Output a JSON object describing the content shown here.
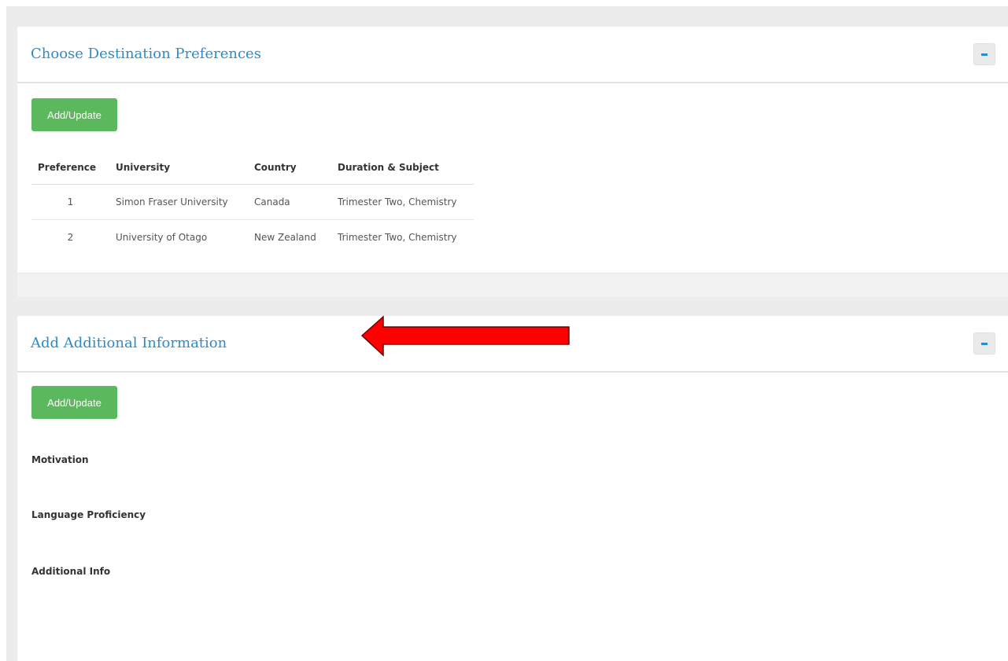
{
  "panels": {
    "destination": {
      "title": "Choose Destination Preferences",
      "add_update_label": "Add/Update",
      "collapse_symbol": "-",
      "table": {
        "headers": [
          "Preference",
          "University",
          "Country",
          "Duration & Subject"
        ],
        "rows": [
          {
            "preference": "1",
            "university": "Simon Fraser University",
            "country": "Canada",
            "duration_subject": "Trimester Two, Chemistry"
          },
          {
            "preference": "2",
            "university": "University of Otago",
            "country": "New Zealand",
            "duration_subject": "Trimester Two, Chemistry"
          }
        ]
      }
    },
    "additional": {
      "title": "Add Additional Information",
      "add_update_label": "Add/Update",
      "collapse_symbol": "-",
      "labels": {
        "motivation": "Motivation",
        "language": "Language Proficiency",
        "additional_info": "Additional Info"
      }
    }
  },
  "colors": {
    "title_blue": "#2b8ccc",
    "button_green": "#5cb85c",
    "arrow_red": "#ff0000",
    "background_gray": "#ececec"
  },
  "annotation": {
    "icon": "left-arrow-icon",
    "direction": "left"
  }
}
